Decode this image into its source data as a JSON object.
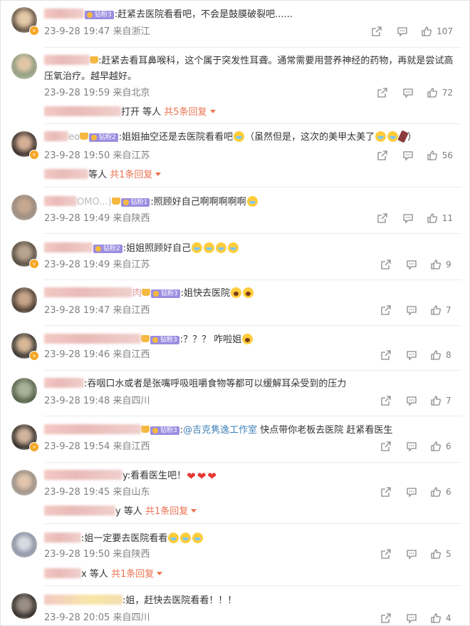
{
  "comments": [
    {
      "text": ":赶紧去医院看看吧，不会是鼓膜破裂吧......",
      "date": "23-9-28 19:47",
      "location": "来自浙江",
      "likes": "107",
      "badge": "钻粉3"
    },
    {
      "text": ":赶紧去看耳鼻喉科，这个属于突发性耳聋。通常需要用营养神经的药物，再就是尝试高压氧治疗。越早越好。",
      "date": "23-9-28 19:59",
      "location": "来自北京",
      "likes": "72",
      "reply_tail": "打开 等人",
      "reply_link": "共5条回复"
    },
    {
      "text": ":姐姐抽空还是去医院看看吧",
      "text2": "（虽然但是，这次的美甲太美了",
      "text3": "）",
      "date": "23-9-28 19:50",
      "location": "来自江苏",
      "likes": "56",
      "badge": "钻粉2",
      "reply_tail": "等人",
      "reply_link": "共1条回复",
      "name_partial": "eo"
    },
    {
      "text": ":照顾好自己啊啊啊啊啊",
      "date": "23-9-28 19:49",
      "location": "来自陕西",
      "likes": "11",
      "badge": "钻粉1",
      "name_partial": "OMO...)"
    },
    {
      "text": ":姐姐照顾好自己",
      "date": "23-9-28 19:49",
      "location": "来自江苏",
      "likes": "9",
      "badge": "钻粉2"
    },
    {
      "text": ":姐快去医院",
      "date": "23-9-28 19:47",
      "location": "来自江西",
      "likes": "7",
      "badge": "钻粉3",
      "name_partial": "肉"
    },
    {
      "text": ":？？？ 咋啦姐",
      "date": "23-9-28 19:46",
      "location": "来自江西",
      "likes": "8",
      "badge": "钻粉3"
    },
    {
      "text": ":吞咽口水或者是张嘴呼吸咀嚼食物等都可以缓解耳朵受到的压力",
      "date": "23-9-28 19:48",
      "location": "来自四川",
      "likes": "7"
    },
    {
      "text_pre": ":",
      "mention": "@吉克隽逸工作室",
      "text": " 快点带你老板去医院 赶紧看医生",
      "date": "23-9-28 19:54",
      "location": "来自江西",
      "likes": "6",
      "badge": "钻粉3"
    },
    {
      "text": "y:看看医生吧！",
      "date": "23-9-28 19:45",
      "location": "来自山东",
      "likes": "6",
      "reply_tail": "y 等人",
      "reply_link": "共1条回复"
    },
    {
      "text": ":姐一定要去医院看看",
      "date": "23-9-28 19:50",
      "location": "来自陕西",
      "likes": "5",
      "reply_tail": "x 等人",
      "reply_link": "共1条回复"
    },
    {
      "text": ":姐，赶快去医院看看！！！",
      "date": "23-9-28 20:05",
      "location": "来自四川",
      "likes": "4"
    }
  ]
}
